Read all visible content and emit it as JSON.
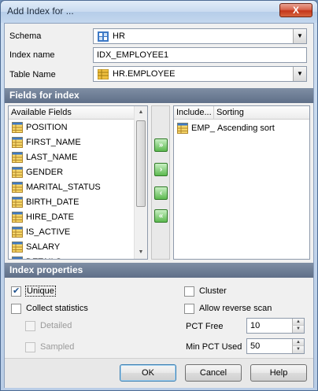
{
  "window": {
    "title": "Add Index for ...",
    "close_label": "X"
  },
  "form": {
    "schema_label": "Schema",
    "schema_value": "HR",
    "index_name_label": "Index name",
    "index_name_value": "IDX_EMPLOYEE1",
    "table_name_label": "Table Name",
    "table_name_value": "HR.EMPLOYEE"
  },
  "fields_section": {
    "title": "Fields for index",
    "available_header": "Available Fields",
    "available_fields": [
      "POSITION",
      "FIRST_NAME",
      "LAST_NAME",
      "GENDER",
      "MARITAL_STATUS",
      "BIRTH_DATE",
      "HIRE_DATE",
      "IS_ACTIVE",
      "SALARY",
      "DETAILS"
    ],
    "included_headers": {
      "included": "Include...",
      "sorting": "Sorting"
    },
    "included_rows": [
      {
        "field": "EMP_",
        "sorting": "Ascending sort"
      }
    ],
    "movers": {
      "add_all": "»",
      "add": "›",
      "remove": "‹",
      "remove_all": "«"
    }
  },
  "properties_section": {
    "title": "Index properties",
    "unique": {
      "label": "Unique",
      "checked": true
    },
    "collect_statistics": {
      "label": "Collect statistics",
      "checked": false
    },
    "detailed": {
      "label": "Detailed",
      "checked": false
    },
    "sampled": {
      "label": "Sampled",
      "checked": false
    },
    "cluster": {
      "label": "Cluster",
      "checked": false
    },
    "allow_reverse_scan": {
      "label": "Allow reverse scan",
      "checked": false
    },
    "pct_free_label": "PCT Free",
    "pct_free_value": "10",
    "min_pct_used_label": "Min PCT Used",
    "min_pct_used_value": "50"
  },
  "buttons": {
    "ok": "OK",
    "cancel": "Cancel",
    "help": "Help"
  },
  "colors": {
    "section_header": "#6b7b93",
    "title_bar": "#c9dbf0",
    "close_button": "#c4361b"
  }
}
